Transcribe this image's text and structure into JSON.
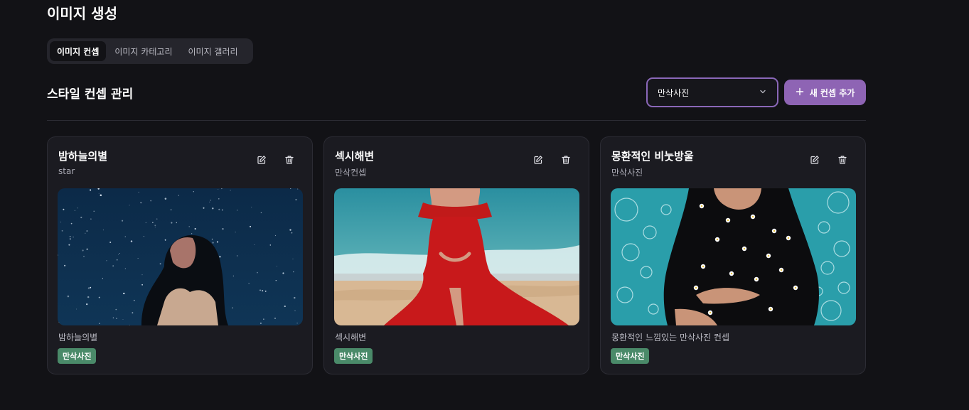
{
  "page": {
    "title": "이미지 생성"
  },
  "tabs": [
    {
      "label": "이미지 컨셉",
      "active": true
    },
    {
      "label": "이미지 카테고리",
      "active": false
    },
    {
      "label": "이미지 갤러리",
      "active": false
    }
  ],
  "section": {
    "title": "스타일 컨셉 관리"
  },
  "filter": {
    "selected": "만삭사진",
    "icon": "chevron-down-icon"
  },
  "add_button": {
    "label": "새 컨셉 추가",
    "icon": "plus-icon"
  },
  "colors": {
    "accent": "#8e64b4",
    "badge": "#4a8a69",
    "background": "#121216",
    "card": "#1b1b21"
  },
  "cards": [
    {
      "title": "밤하늘의별",
      "subtitle": "star",
      "image": "woman-under-starry-night-sky",
      "description": "밤하늘의별",
      "badge": "만삭사진",
      "actions": [
        "edit-icon",
        "trash-icon"
      ]
    },
    {
      "title": "섹시해변",
      "subtitle": "만삭컨셉",
      "image": "pregnant-woman-red-dress-beach",
      "description": "섹시해변",
      "badge": "만삭사진",
      "actions": [
        "edit-icon",
        "trash-icon"
      ]
    },
    {
      "title": "몽환적인 비눗방울",
      "subtitle": "만삭사진",
      "image": "pregnant-woman-black-dress-bubbles",
      "description": "몽환적인 느낌있는 만삭사진 컨셉",
      "badge": "만삭사진",
      "actions": [
        "edit-icon",
        "trash-icon"
      ]
    }
  ]
}
